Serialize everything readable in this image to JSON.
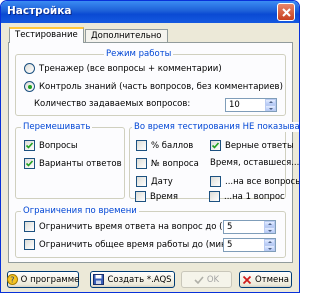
{
  "window": {
    "title": "Настройка"
  },
  "tabs": [
    {
      "label": "Тестирование",
      "active": true
    },
    {
      "label": "Дополнительно",
      "active": false
    }
  ],
  "mode": {
    "legend": "Режим работы",
    "trainer_label": "Тренажер (все вопросы + комментарии)",
    "control_label": "Контроль знаний (часть вопросов, без комментариев)",
    "selected": "control",
    "count_label": "Количество задаваемых вопросов:",
    "count_value": "10"
  },
  "shuffle": {
    "legend": "Перемешивать",
    "questions_label": "Вопросы",
    "questions_checked": true,
    "answers_label": "Варианты ответов",
    "answers_checked": true
  },
  "hide": {
    "legend": "Во время тестирования НЕ показывать",
    "items": [
      {
        "label": "% баллов",
        "checked": false
      },
      {
        "label": "Верные ответы",
        "checked": true
      },
      {
        "label": "№ вопроса",
        "checked": false
      },
      {
        "label": "Время, оставшеся...",
        "checked": false
      },
      {
        "label": "Дату",
        "checked": false
      },
      {
        "label": "...на все вопросы",
        "checked": false
      },
      {
        "label": "Время",
        "checked": false
      },
      {
        "label": "...на 1 вопрос",
        "checked": false
      }
    ]
  },
  "time": {
    "legend": "Ограничения по времени",
    "answer_label": "Ограничить время ответа на вопрос до (сек)",
    "answer_checked": false,
    "answer_value": "5",
    "total_label": "Ограничить общее время работы до (мин)",
    "total_checked": false,
    "total_value": "5"
  },
  "buttons": {
    "about": "О программе",
    "create": "Создать *.AQS",
    "ok": "OK",
    "cancel": "Отмена"
  }
}
